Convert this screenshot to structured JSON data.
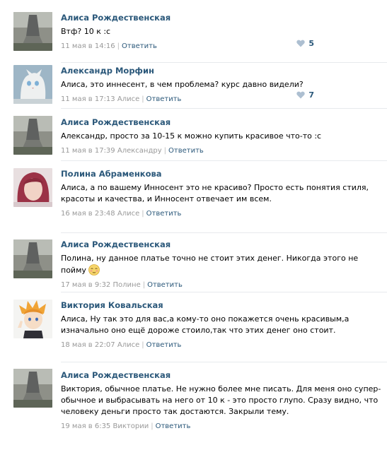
{
  "comments": [
    {
      "author": "Алиса Рождественская",
      "text": "Втф? 10 к :с",
      "date": "11 мая в 14:16",
      "reply_to": "",
      "reply_label": "Ответить",
      "likes": "5"
    },
    {
      "author": "Александр Морфин",
      "text": "Алиса, это иннесент, в чем проблема? курс давно видели?",
      "date": "11 мая в 17:13",
      "reply_to": "Алисе",
      "reply_label": "Ответить",
      "likes": "7"
    },
    {
      "author": "Алиса Рождественская",
      "text": "Александр, просто за 10-15 к можно купить красивое что-то :с",
      "date": "11 мая в 17:39",
      "reply_to": "Александру",
      "reply_label": "Ответить",
      "likes": ""
    },
    {
      "author": "Полина Абраменкова",
      "text": "Алиса, а по вашему Инносент это не красиво? Просто есть понятия стиля, красоты и качества, и Инносент отвечает им всем.",
      "date": "16 мая в 23:48",
      "reply_to": "Алисе",
      "reply_label": "Ответить",
      "likes": ""
    },
    {
      "author": "Алиса Рождественская",
      "text": "Полина, ну данное платье точно не стоит этих денег. Никогда этого не пойму",
      "date": "17 мая в 9:32",
      "reply_to": "Полине",
      "reply_label": "Ответить",
      "likes": ""
    },
    {
      "author": "Виктория Ковальская",
      "text": "Алиса, Ну так это для вас,а кому-то оно покажется очень красивым,а изначально оно ещё дороже стоило,так что этих денег оно стоит.",
      "date": "18 мая в 22:07",
      "reply_to": "Алисе",
      "reply_label": "Ответить",
      "likes": ""
    },
    {
      "author": "Алиса Рождественская",
      "text": "Виктория, обычное платье. Не нужно более мне писать. Для меня оно супер-обычное и выбрасывать на него от 10 к - это просто глупо. Сразу видно, что человеку деньги просто так достаются. Закрыли тему.",
      "date": "19 мая в 6:35",
      "reply_to": "Виктории",
      "reply_label": "Ответить",
      "likes": ""
    }
  ],
  "colors": {
    "link": "#2b587a",
    "meta": "#999999",
    "like_heart": "#adbfd1",
    "divider": "#e7eaed"
  },
  "icons": {
    "like": "heart-icon",
    "emoji": "blushing-face-emoji"
  }
}
